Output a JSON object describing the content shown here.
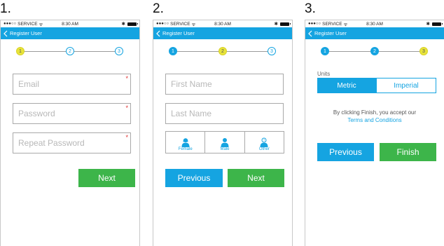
{
  "status_bar": {
    "carrier": "SERVICE",
    "time": "8:30 AM"
  },
  "nav": {
    "title": "Register User"
  },
  "colors": {
    "accent": "#15a4e1",
    "success": "#3db54a",
    "active_step": "#e8e43a",
    "required": "#e03030"
  },
  "screens": [
    {
      "number": "1.",
      "steps": [
        "1",
        "2",
        "3"
      ],
      "fields": [
        {
          "placeholder": "Email",
          "required_mark": "*"
        },
        {
          "placeholder": "Password",
          "required_mark": "*"
        },
        {
          "placeholder": "Repeat Password",
          "required_mark": "*"
        }
      ],
      "next_label": "Next"
    },
    {
      "number": "2.",
      "steps": [
        "1",
        "2",
        "3"
      ],
      "fields": [
        {
          "placeholder": "First Name"
        },
        {
          "placeholder": "Last Name"
        }
      ],
      "genders": [
        {
          "label": "Female",
          "icon": "female-user-icon"
        },
        {
          "label": "Male",
          "icon": "male-user-icon"
        },
        {
          "label": "Other",
          "icon": "other-user-icon"
        }
      ],
      "previous_label": "Previous",
      "next_label": "Next"
    },
    {
      "number": "3.",
      "steps": [
        "1",
        "2",
        "3"
      ],
      "units_label": "Units",
      "units_options": [
        "Metric",
        "Imperial"
      ],
      "terms_text": "By clicking Finish, you accept our",
      "terms_link": "Terms and Conditions",
      "previous_label": "Previous",
      "finish_label": "Finish"
    }
  ]
}
